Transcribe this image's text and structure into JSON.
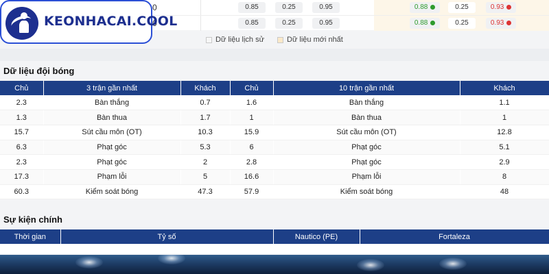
{
  "odds_rows": [
    {
      "frag": "0",
      "left": [
        "0.85",
        "0.25",
        "0.95"
      ],
      "right": [
        "0.88",
        "0.25",
        "0.93"
      ]
    },
    {
      "frag": "0",
      "left": [
        "0.85",
        "0.25",
        "0.95"
      ],
      "right": [
        "0.88",
        "0.25",
        "0.93"
      ]
    }
  ],
  "logo": {
    "text": "KEONHACAI.COOL"
  },
  "legend": {
    "history": "Dữ liệu lịch sử",
    "latest": "Dữ liệu mới nhất"
  },
  "team_data": {
    "title": "Dữ liệu đội bóng",
    "headers": [
      "Chủ",
      "3 trận gần nhất",
      "Khách",
      "Chủ",
      "10 trận gần nhất",
      "Khách"
    ],
    "rows": [
      [
        "2.3",
        "Bàn thắng",
        "0.7",
        "1.6",
        "Bàn thắng",
        "1.1"
      ],
      [
        "1.3",
        "Bàn thua",
        "1.7",
        "1",
        "Bàn thua",
        "1"
      ],
      [
        "15.7",
        "Sút cầu môn (OT)",
        "10.3",
        "15.9",
        "Sút cầu môn (OT)",
        "12.8"
      ],
      [
        "6.3",
        "Phạt góc",
        "5.3",
        "6",
        "Phạt góc",
        "5.1"
      ],
      [
        "2.3",
        "Phạt góc",
        "2",
        "2.8",
        "Phạt góc",
        "2.9"
      ],
      [
        "17.3",
        "Phạm lỗi",
        "5",
        "16.6",
        "Phạm lỗi",
        "8"
      ],
      [
        "60.3",
        "Kiểm soát bóng",
        "47.3",
        "57.9",
        "Kiểm soát bóng",
        "48"
      ]
    ]
  },
  "events": {
    "title": "Sự kiện chính",
    "headers": [
      "Thời gian",
      "Tỷ số",
      "Nautico (PE)",
      "Fortaleza"
    ]
  },
  "colors": {
    "header_bg": "#1d3f87",
    "up": "#2e9b2e",
    "down": "#d33333",
    "logo_blue": "#1d2f8f"
  }
}
